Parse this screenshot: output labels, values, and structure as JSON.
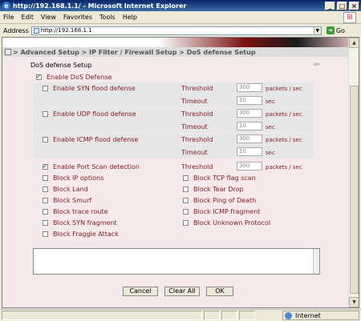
{
  "window": {
    "title": "http://192.168.1.1/ - Microsoft Internet Explorer"
  },
  "menu": [
    "File",
    "Edit",
    "View",
    "Favorites",
    "Tools",
    "Help"
  ],
  "address": {
    "label": "Address",
    "url": "http://192.168.1.1",
    "go": "Go"
  },
  "breadcrumb": "> Advanced Setup > IP Filter / Firewall Setup > DoS defense Setup",
  "page": {
    "title": "DoS defense Setup",
    "enable_dos": {
      "label": "Enable DoS Defense",
      "checked": true
    },
    "groups": [
      {
        "label": "Enable SYN flood defense",
        "checked": false,
        "threshold_label": "Threshold",
        "threshold": "300",
        "threshold_unit": "packets / sec",
        "timeout_label": "Timeout",
        "timeout": "10",
        "timeout_unit": "sec"
      },
      {
        "label": "Enable UDP flood defense",
        "checked": false,
        "threshold_label": "Threshold",
        "threshold": "300",
        "threshold_unit": "packets / sec",
        "timeout_label": "Timeout",
        "timeout": "10",
        "timeout_unit": "sec"
      },
      {
        "label": "Enable ICMP flood defense",
        "checked": false,
        "threshold_label": "Threshold",
        "threshold": "300",
        "threshold_unit": "packets / sec",
        "timeout_label": "Timeout",
        "timeout": "10",
        "timeout_unit": "sec"
      }
    ],
    "port_scan": {
      "label": "Enable Port Scan detection",
      "checked": true,
      "threshold_label": "Threshold",
      "threshold": "300",
      "threshold_unit": "packets / sec"
    },
    "blocks_left": [
      "Block IP options",
      "Block Land",
      "Block Smurf",
      "Block trace route",
      "Block SYN fragment",
      "Block Fraggle Attack"
    ],
    "blocks_right": [
      "Block TCP flag scan",
      "Block Tear Drop",
      "Block Ping of Death",
      "Block ICMP fragment",
      "Block Unknown Protocol"
    ],
    "buttons": {
      "cancel": "Cancel",
      "clear_all": "Clear All",
      "ok": "OK"
    }
  },
  "status": {
    "zone": "Internet"
  }
}
